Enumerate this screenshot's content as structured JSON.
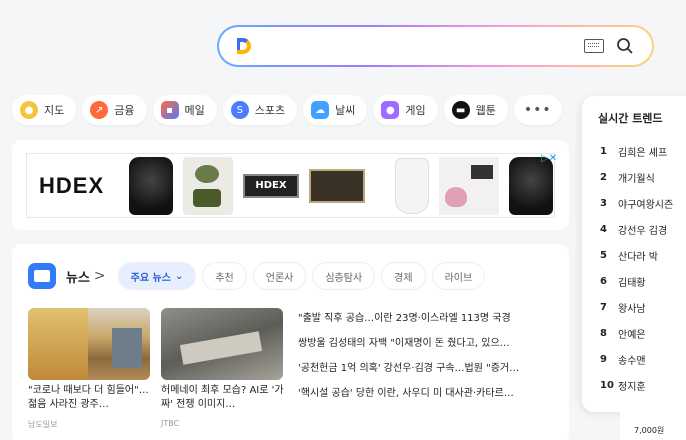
{
  "search": {
    "placeholder": ""
  },
  "categories": [
    {
      "label": "지도",
      "color": "#f6c43c",
      "icon": "map-pin-icon"
    },
    {
      "label": "금융",
      "color": "#ff6a3d",
      "icon": "finance-icon"
    },
    {
      "label": "메일",
      "color": "#4f7bff",
      "icon": "mail-icon"
    },
    {
      "label": "스포츠",
      "color": "#4f7bff",
      "icon": "sports-icon"
    },
    {
      "label": "날씨",
      "color": "#3ea0ff",
      "icon": "weather-icon"
    },
    {
      "label": "게임",
      "color": "#a06bff",
      "icon": "game-icon"
    },
    {
      "label": "웹툰",
      "color": "#111111",
      "icon": "webtoon-icon"
    }
  ],
  "ad": {
    "brand": "HDEX",
    "label_text": "HDEX"
  },
  "news": {
    "title": "뉴스",
    "tabs": [
      "주요 뉴스",
      "추천",
      "언론사",
      "심층탐사",
      "경제",
      "라이브"
    ],
    "cards": [
      {
        "caption": "\"코로나 때보다 더 힘들어\"…젊음 사라진 광주…",
        "source": "남도일보"
      },
      {
        "caption": "허메네이 최후 모습? AI로 '가짜' 전쟁 이미지…",
        "source": "JTBC"
      }
    ],
    "headlines": [
      "\"출발 직후 공습…이란 23명·이스라엘 113명 국경",
      "쌍방울 김성태의 자백 \"이재명이 돈 줬다고, 있으…",
      "'공천헌금 1억 의혹' 강선우·김경 구속…법원 \"증거…",
      "'핵시설 공습' 당한 이란, 사우디 미 대사관·카타르…"
    ]
  },
  "trends": {
    "title": "실시간 트렌드",
    "items": [
      {
        "rank": "1",
        "text": "김희은 셰프"
      },
      {
        "rank": "2",
        "text": "개기월식"
      },
      {
        "rank": "3",
        "text": "야구여왕시즌"
      },
      {
        "rank": "4",
        "text": "강선우 김경"
      },
      {
        "rank": "5",
        "text": "산다라 박"
      },
      {
        "rank": "6",
        "text": "김태황"
      },
      {
        "rank": "7",
        "text": "왕사남"
      },
      {
        "rank": "8",
        "text": "안예은"
      },
      {
        "rank": "9",
        "text": "송수맨"
      },
      {
        "rank": "10",
        "text": "정지훈"
      }
    ]
  },
  "footer_price": "7,000원"
}
